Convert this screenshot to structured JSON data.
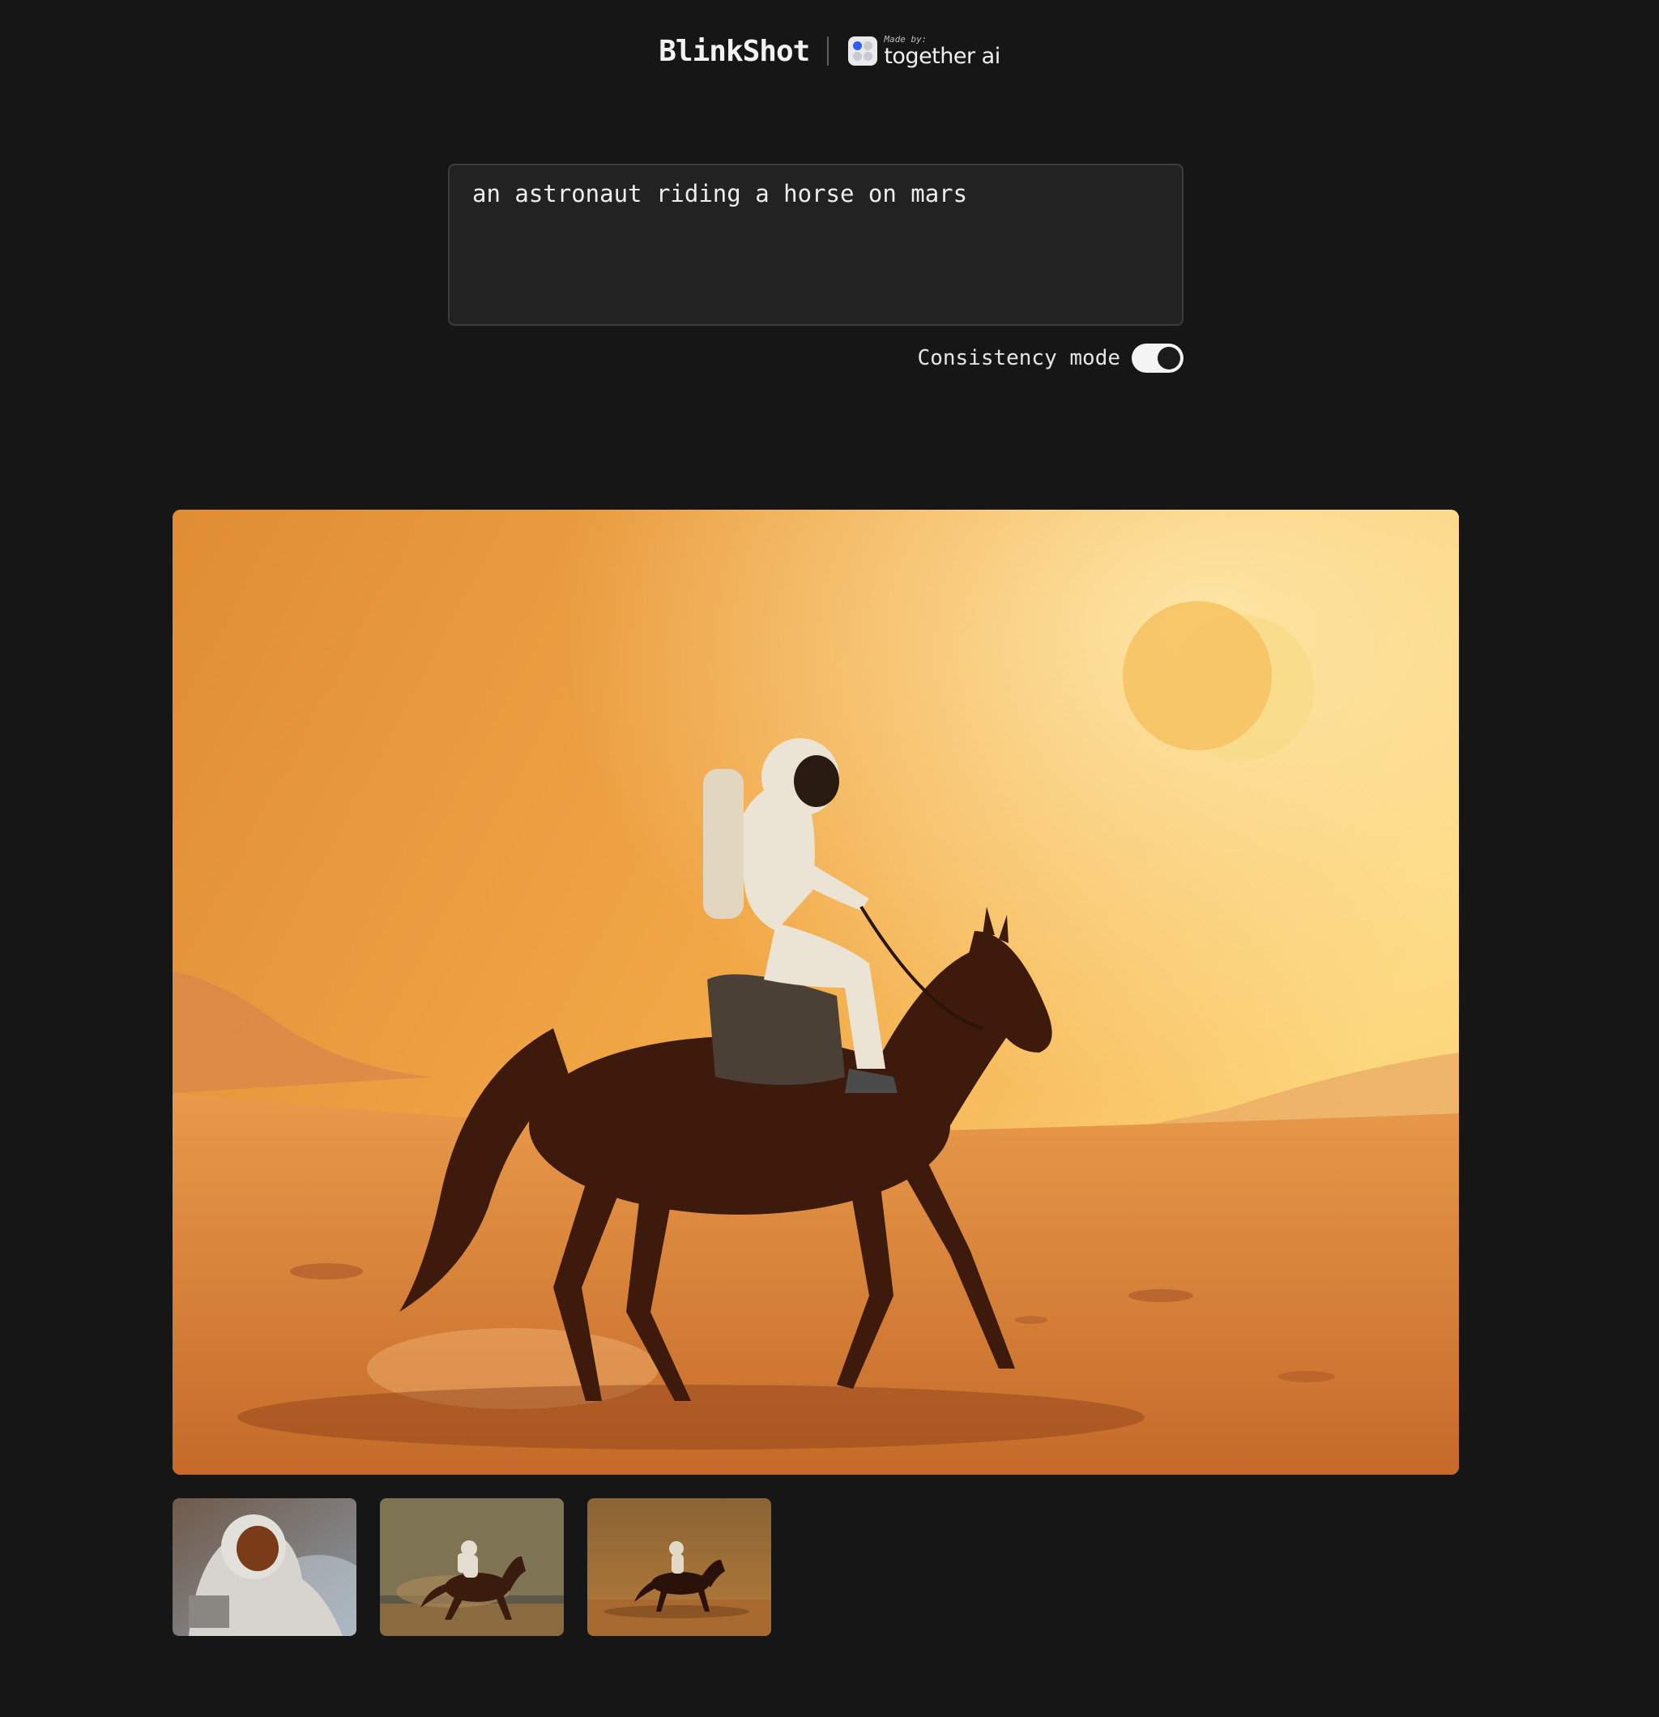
{
  "header": {
    "brand": "BlinkShot",
    "made_by_label": "Made by:",
    "made_by_name": "together ai"
  },
  "prompt": {
    "value": "an astronaut riding a horse on mars"
  },
  "consistency_mode": {
    "label": "Consistency mode",
    "enabled": true
  },
  "images": {
    "main": "astronaut riding horse on mars",
    "thumbnails": [
      "astronaut-closeup",
      "astronaut-horse-galloping",
      "astronaut-horse-desert"
    ]
  },
  "colors": {
    "background": "#161616",
    "prompt_bg": "#222222",
    "text": "#ededed",
    "toggle_on": "#f4f4f4"
  }
}
